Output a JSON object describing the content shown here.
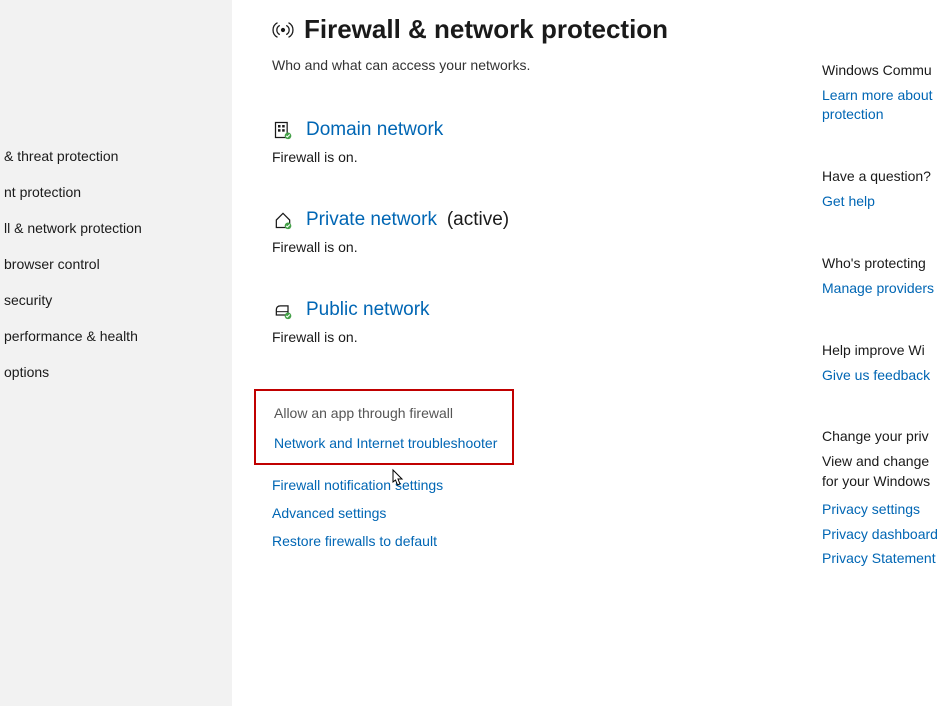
{
  "sidebar": {
    "items": [
      {
        "label": "& threat protection"
      },
      {
        "label": "nt protection"
      },
      {
        "label": "ll & network protection"
      },
      {
        "label": " browser control"
      },
      {
        "label": " security"
      },
      {
        "label": " performance & health"
      },
      {
        "label": " options"
      }
    ]
  },
  "page": {
    "title": "Firewall & network protection",
    "subtitle": "Who and what can access your networks."
  },
  "networks": [
    {
      "title": "Domain network",
      "suffix": "",
      "status": "Firewall is on."
    },
    {
      "title": "Private network",
      "suffix": "(active)",
      "status": "Firewall is on."
    },
    {
      "title": "Public network",
      "suffix": "",
      "status": "Firewall is on."
    }
  ],
  "actions": {
    "allow_app": "Allow an app through firewall",
    "troubleshooter": "Network and Internet troubleshooter",
    "notification": "Firewall notification settings",
    "advanced": "Advanced settings",
    "restore": "Restore firewalls to default"
  },
  "right": {
    "community": {
      "heading": "Windows Commu",
      "link": "Learn more about\nprotection"
    },
    "question": {
      "heading": "Have a question?",
      "link": "Get help"
    },
    "protecting": {
      "heading": "Who's protecting",
      "link": "Manage providers"
    },
    "improve": {
      "heading": "Help improve Wi",
      "link": "Give us feedback"
    },
    "privacy": {
      "heading": "Change your priv",
      "text": "View and change\nfor your Windows",
      "links": [
        "Privacy settings",
        "Privacy dashboard",
        "Privacy Statement"
      ]
    }
  }
}
